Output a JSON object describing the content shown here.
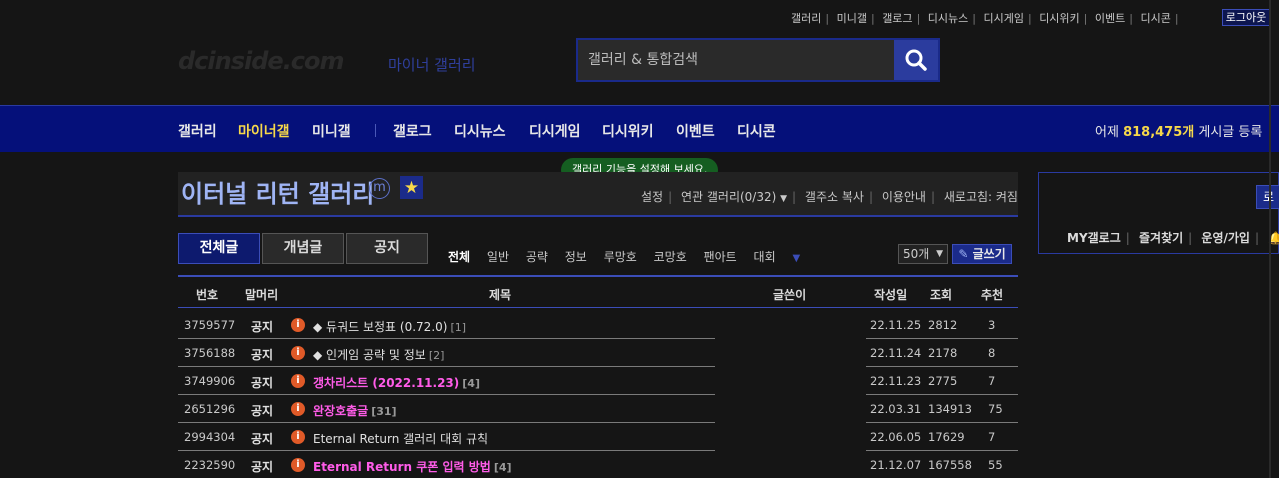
{
  "top_links": [
    "갤러리",
    "미니갤",
    "갤로그",
    "디시뉴스",
    "디시게임",
    "디시위키",
    "이벤트",
    "디시콘"
  ],
  "logout_label": "로그아웃",
  "logo": {
    "text": "dcinside.com",
    "sub": "마이너 갤러리"
  },
  "search": {
    "placeholder": "갤러리 & 통합검색"
  },
  "gnb": {
    "items": [
      "갤러리",
      "마이너갤",
      "미니갤",
      "갤로그",
      "디시뉴스",
      "디시게임",
      "디시위키",
      "이벤트",
      "디시콘"
    ],
    "active_index": 1,
    "stat_prefix": "어제",
    "stat_value": "818,475개",
    "stat_suffix": "게시글 등록"
  },
  "tooltip": "갤러리 기능을 설정해 보세요.",
  "gallery": {
    "title": "이터널 리턴 갤러리",
    "mini_mark": "m",
    "options": [
      "설정",
      "연관 갤러리(0/32)",
      "갤주소 복사",
      "이용안내",
      "새로고침: 켜짐"
    ]
  },
  "tabs": [
    "전체글",
    "개념글",
    "공지"
  ],
  "sub_tabs": [
    "전체",
    "일반",
    "공략",
    "정보",
    "루망호",
    "코망호",
    "팬아트",
    "대회"
  ],
  "list_count": "50개",
  "write_label": "글쓰기",
  "table": {
    "headers": {
      "num": "번호",
      "head": "말머리",
      "subject": "제목",
      "writer": "글쓴이",
      "date": "작성일",
      "views": "조회",
      "rec": "추천"
    },
    "rows": [
      {
        "num": "3759577",
        "head": "공지",
        "subject": "◆ 듀궈드 보정표 (0.72.0)",
        "comments": "[1]",
        "date": "22.11.25",
        "views": "2812",
        "rec": "3",
        "highlight": false
      },
      {
        "num": "3756188",
        "head": "공지",
        "subject": "◆ 인게임 공략 및 정보",
        "comments": "[2]",
        "date": "22.11.24",
        "views": "2178",
        "rec": "8",
        "highlight": false
      },
      {
        "num": "3749906",
        "head": "공지",
        "subject": "갱차리스트 (2022.11.23)",
        "comments": "[4]",
        "date": "22.11.23",
        "views": "2775",
        "rec": "7",
        "highlight": true
      },
      {
        "num": "2651296",
        "head": "공지",
        "subject": "완장호출글",
        "comments": "[31]",
        "date": "22.03.31",
        "views": "134913",
        "rec": "75",
        "highlight": true
      },
      {
        "num": "2994304",
        "head": "공지",
        "subject": "Eternal Return 갤러리 대회 규칙",
        "comments": "",
        "date": "22.06.05",
        "views": "17629",
        "rec": "7",
        "highlight": false
      },
      {
        "num": "2232590",
        "head": "공지",
        "subject": "Eternal Return 쿠폰 입력 방법",
        "comments": "[4]",
        "date": "21.12.07",
        "views": "167558",
        "rec": "55",
        "highlight": true
      }
    ]
  },
  "side": {
    "login_label": "로그인",
    "links": [
      "MY갤로그",
      "즐겨찾기",
      "운영/가입"
    ]
  },
  "colors": {
    "accent_navy": "#05107a",
    "highlight_pink": "#ff5ce8",
    "active_yellow": "#f6d84a"
  }
}
